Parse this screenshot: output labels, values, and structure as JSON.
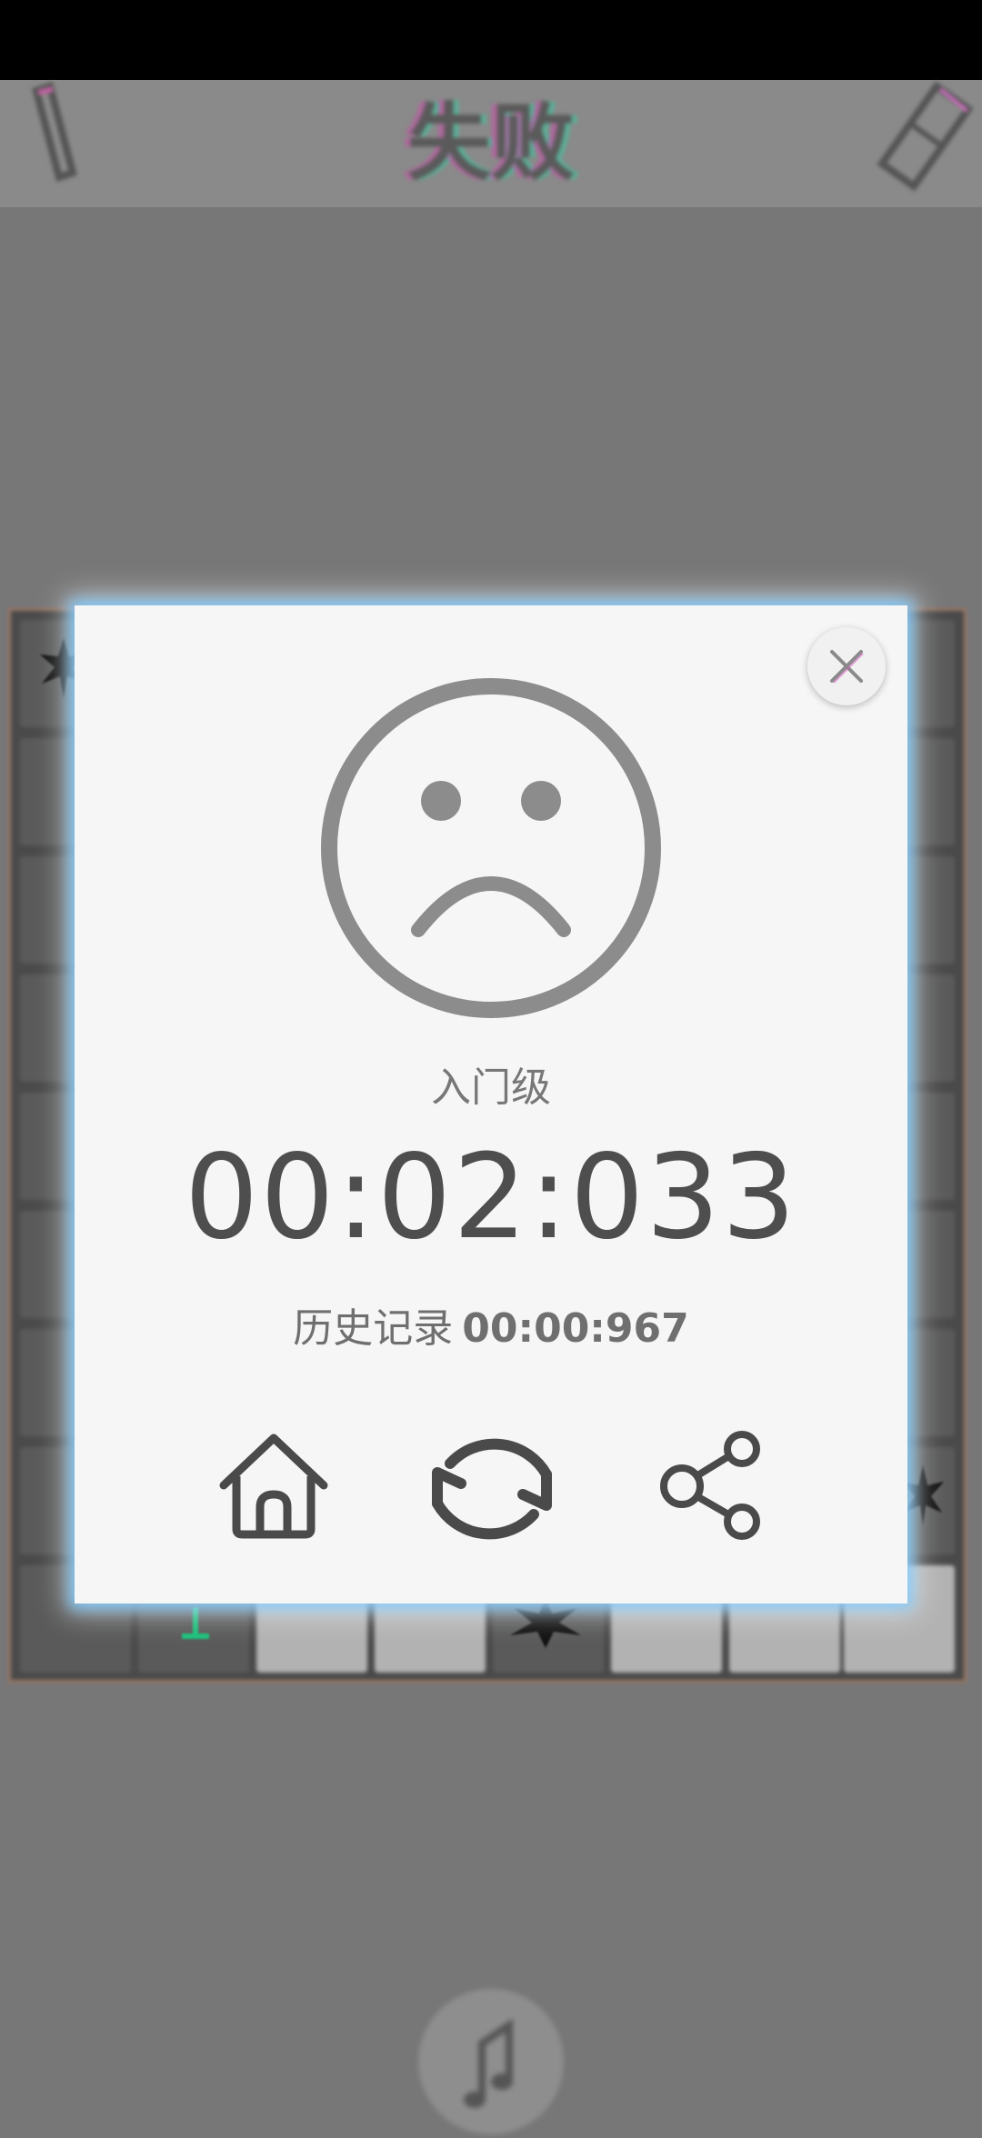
{
  "header": {
    "title": "失败"
  },
  "result_dialog": {
    "level": "入门级",
    "time": "00:02:033",
    "record_label": "历史记录",
    "record_time": "00:00:967",
    "buttons": [
      "home",
      "restart",
      "share"
    ]
  },
  "icons": {
    "close": "close-icon",
    "face": "sad-face-icon",
    "home": "home-icon",
    "restart": "refresh-icon",
    "share": "share-icon",
    "pencil": "pencil-icon",
    "eraser": "eraser-icon",
    "music": "music-note-icon",
    "mine": "mine-icon"
  },
  "colors": {
    "overlay": "#777777",
    "dialog": "#f6f6f6",
    "text_dark": "#4e4e4e",
    "text_mid": "#777777",
    "flag": "#1bbf7a"
  }
}
